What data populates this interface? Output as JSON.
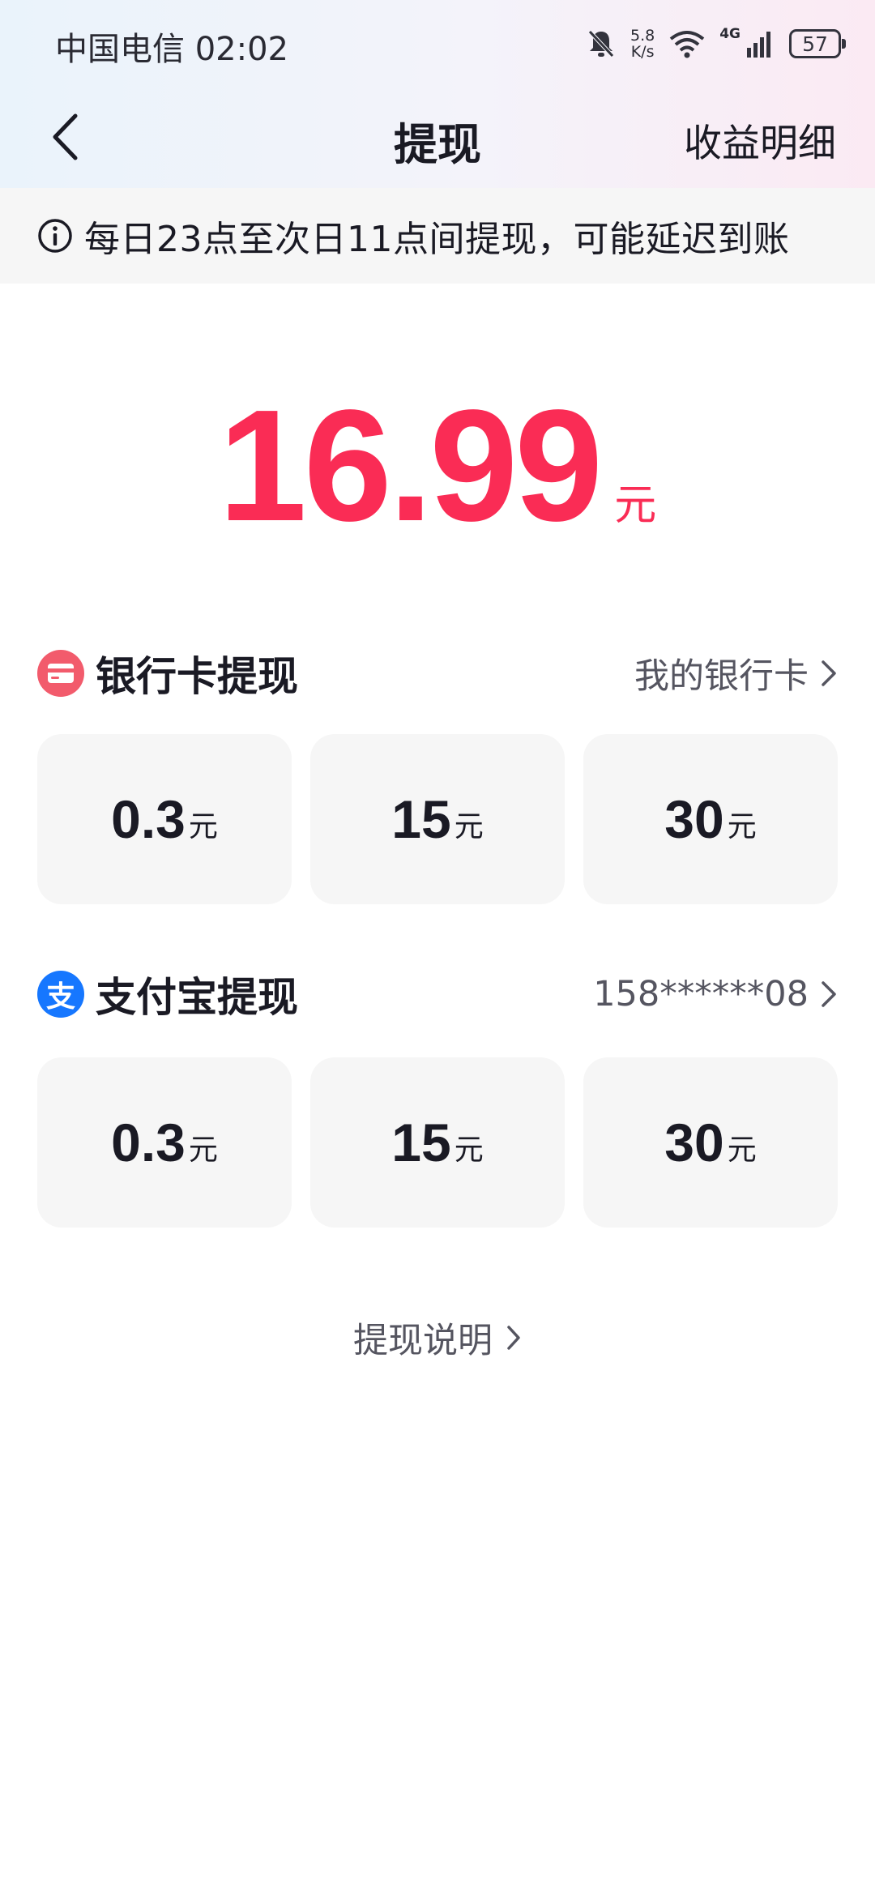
{
  "status_bar": {
    "carrier_time": "中国电信 02:02",
    "net_speed_value": "5.8",
    "net_speed_unit": "K/s",
    "network_type": "4G",
    "battery": "57"
  },
  "nav": {
    "title": "提现",
    "right_link": "收益明细"
  },
  "notice": {
    "text": "每日23点至次日11点间提现，可能延迟到账"
  },
  "balance": {
    "amount": "16.99",
    "unit": "元"
  },
  "bank_section": {
    "title": "银行卡提现",
    "link": "我的银行卡",
    "options": [
      {
        "value": "0.3",
        "unit": "元"
      },
      {
        "value": "15",
        "unit": "元"
      },
      {
        "value": "30",
        "unit": "元"
      }
    ]
  },
  "alipay_section": {
    "title": "支付宝提现",
    "link": "158******08",
    "icon_glyph": "支",
    "options": [
      {
        "value": "0.3",
        "unit": "元"
      },
      {
        "value": "15",
        "unit": "元"
      },
      {
        "value": "30",
        "unit": "元"
      }
    ]
  },
  "footer": {
    "explain_link": "提现说明"
  },
  "colors": {
    "accent": "#fa2c55",
    "bank_icon": "#f25b6c",
    "alipay_icon": "#1677ff"
  }
}
